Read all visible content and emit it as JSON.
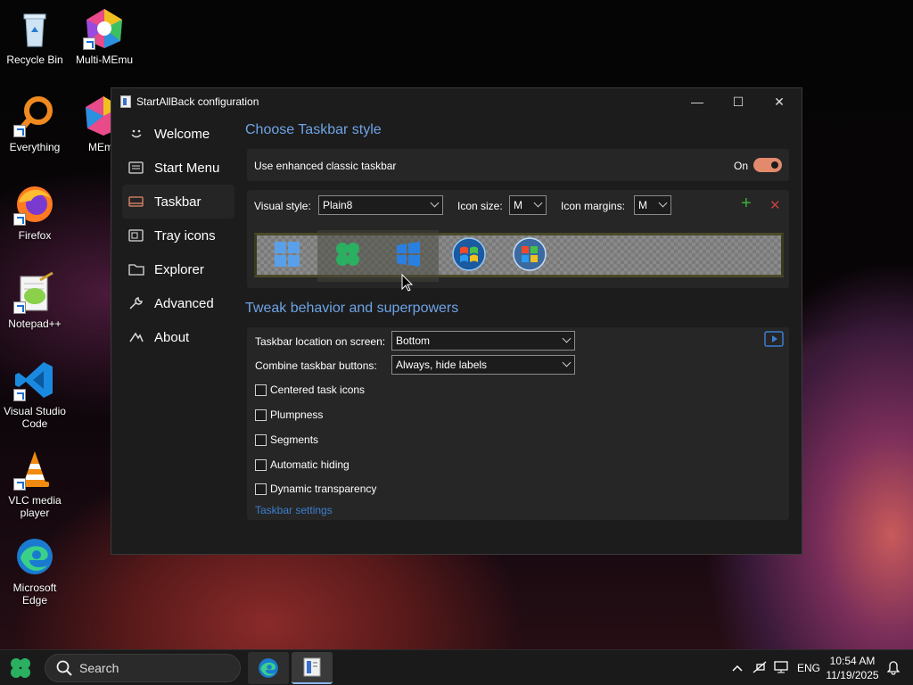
{
  "desktop_icons": [
    {
      "label": "Recycle Bin",
      "icon": "recycle-bin-icon"
    },
    {
      "label": "Multi-MEmu",
      "icon": "multi-memu-icon"
    },
    {
      "label": "Everything",
      "icon": "everything-icon"
    },
    {
      "label": "MEm",
      "icon": "memu-icon"
    },
    {
      "label": "Firefox",
      "icon": "firefox-icon"
    },
    {
      "label": "Notepad++",
      "icon": "notepadpp-icon"
    },
    {
      "label": "Visual Studio Code",
      "icon": "vscode-icon"
    },
    {
      "label": "VLC media player",
      "icon": "vlc-icon"
    },
    {
      "label": "Microsoft Edge",
      "icon": "edge-icon"
    }
  ],
  "window": {
    "title": "StartAllBack configuration",
    "controls": {
      "minimize": "—",
      "maximize": "☐",
      "close": "✕"
    }
  },
  "sidebar": {
    "items": [
      {
        "label": "Welcome",
        "icon": "smile-icon"
      },
      {
        "label": "Start Menu",
        "icon": "start-menu-icon"
      },
      {
        "label": "Taskbar",
        "icon": "taskbar-icon",
        "active": true
      },
      {
        "label": "Tray icons",
        "icon": "tray-icon"
      },
      {
        "label": "Explorer",
        "icon": "folder-icon"
      },
      {
        "label": "Advanced",
        "icon": "wrench-icon"
      },
      {
        "label": "About",
        "icon": "about-icon"
      }
    ]
  },
  "taskbar_style": {
    "section_title": "Choose Taskbar style",
    "enhanced_label": "Use enhanced classic taskbar",
    "enhanced_state": "On",
    "enhanced_on": true,
    "visual_style_label": "Visual style:",
    "visual_style_value": "Plain8",
    "icon_size_label": "Icon size:",
    "icon_size_value": "M",
    "icon_margins_label": "Icon margins:",
    "icon_margins_value": "M",
    "add_symbol": "+",
    "remove_symbol": "✕"
  },
  "behavior": {
    "section_title": "Tweak behavior and superpowers",
    "location_label": "Taskbar location on screen:",
    "location_value": "Bottom",
    "combine_label": "Combine taskbar buttons:",
    "combine_value": "Always, hide labels",
    "checkboxes": [
      {
        "label": "Centered task icons",
        "checked": false
      },
      {
        "label": "Plumpness",
        "checked": false
      },
      {
        "label": "Segments",
        "checked": false
      },
      {
        "label": "Automatic hiding",
        "checked": false
      },
      {
        "label": "Dynamic transparency",
        "checked": false
      }
    ],
    "settings_link": "Taskbar settings"
  },
  "taskbar": {
    "search_text": "Search",
    "tray_lang": "ENG",
    "time": "10:54 AM",
    "date": "11/19/2025"
  },
  "colors": {
    "accent_link": "#6ea3e6",
    "toggle_on": "#e38a6c",
    "window_bg": "#1c1c1c",
    "panel_bg": "#262626"
  }
}
